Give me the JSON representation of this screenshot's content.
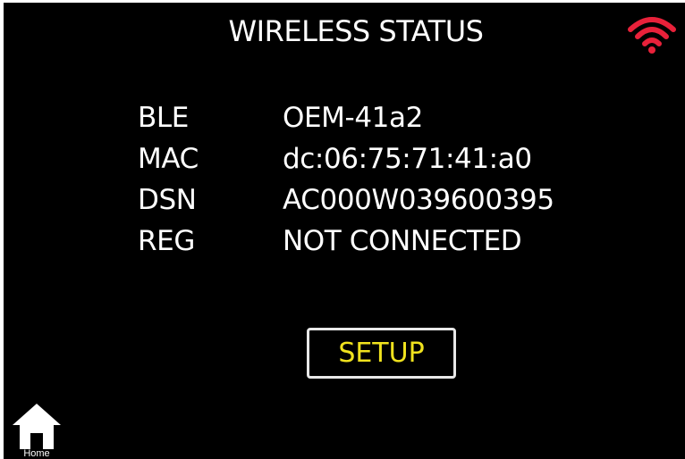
{
  "header": {
    "title": "WIRELESS STATUS",
    "status_icon": "wifi-icon",
    "status_icon_color": "#e8213a"
  },
  "info": {
    "rows": [
      {
        "label": "BLE",
        "value": "OEM-41a2"
      },
      {
        "label": "MAC",
        "value": "dc:06:75:71:41:a0"
      },
      {
        "label": "DSN",
        "value": "AC000W039600395"
      },
      {
        "label": "REG",
        "value": "NOT CONNECTED"
      }
    ]
  },
  "actions": {
    "setup_label": "SETUP",
    "setup_color": "#f0e21e"
  },
  "nav": {
    "home_label": "Home",
    "home_icon": "home-icon"
  }
}
